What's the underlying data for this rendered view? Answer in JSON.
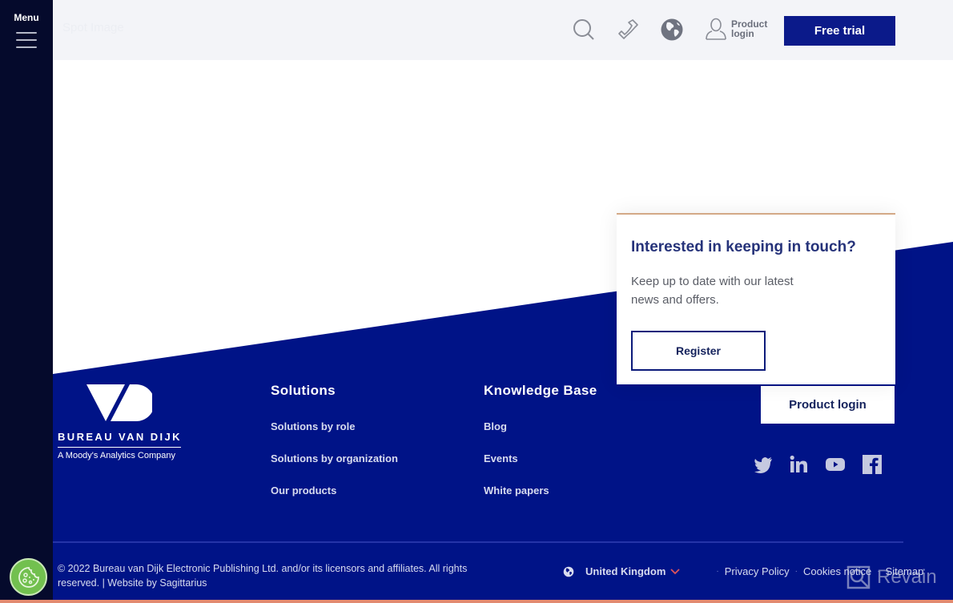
{
  "sidebar": {
    "menu_label": "Menu"
  },
  "header": {
    "faint_title": "Spot Image",
    "product_login_label": "Product login",
    "free_trial_label": "Free trial",
    "icons": [
      "search-icon",
      "phone-icon",
      "globe-icon",
      "user-icon"
    ]
  },
  "touch_card": {
    "title": "Interested in keeping in touch?",
    "description": "Keep up to date with our latest news and offers.",
    "register_label": "Register"
  },
  "footer": {
    "logo": {
      "name": "BUREAU VAN DIJK",
      "tagline": "A Moody's Analytics Company"
    },
    "columns": [
      {
        "title": "Solutions",
        "links": [
          "Solutions by role",
          "Solutions by organization",
          "Our products"
        ]
      },
      {
        "title": "Knowledge Base",
        "links": [
          "Blog",
          "Events",
          "White papers"
        ]
      }
    ],
    "product_login_label": "Product login",
    "social": [
      "twitter-icon",
      "linkedin-icon",
      "youtube-icon",
      "facebook-icon"
    ],
    "copyright": "© 2022 Bureau van Dijk Electronic Publishing Ltd. and/or its licensors and affiliates. All rights reserved. | Website by Sagittarius",
    "country": "United Kingdom",
    "links": [
      "Privacy Policy",
      "Cookies notice",
      "Sitemap"
    ]
  },
  "watermark": {
    "text": "Revain"
  },
  "colors": {
    "brand_blue": "#001387",
    "sidebar_dark": "#050a2c",
    "button_blue": "#0b1a8a",
    "cookie_green": "#72c04f",
    "accent_line": "#d3a987",
    "chevron_red": "#e0545a",
    "bottom_strip": "#e28a70"
  }
}
